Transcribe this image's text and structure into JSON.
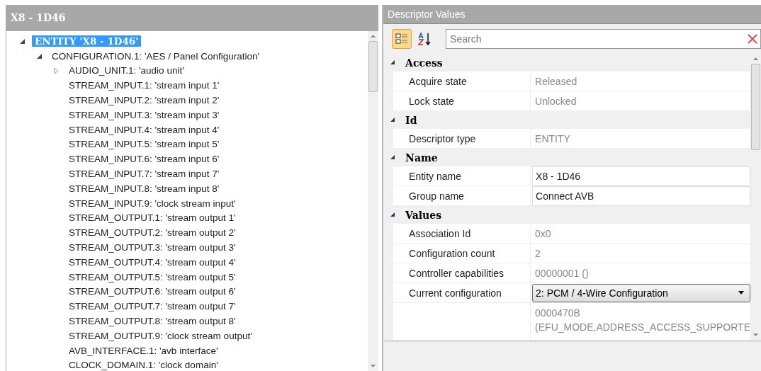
{
  "tree_panel": {
    "title": "X8 - 1D46",
    "tree": [
      {
        "label": "ENTITY 'X8 - 1D46'",
        "selected": true,
        "expanded": true,
        "children": [
          {
            "label": "CONFIGURATION.1: 'AES / Panel Configuration'",
            "selected": false,
            "expanded": true,
            "children": [
              {
                "label": "AUDIO_UNIT.1: 'audio unit'",
                "selected": false,
                "expanded": false
              },
              {
                "label": "STREAM_INPUT.1: 'stream input 1'",
                "selected": false
              },
              {
                "label": "STREAM_INPUT.2: 'stream input 2'",
                "selected": false
              },
              {
                "label": "STREAM_INPUT.3: 'stream input 3'",
                "selected": false
              },
              {
                "label": "STREAM_INPUT.4: 'stream input 4'",
                "selected": false
              },
              {
                "label": "STREAM_INPUT.5: 'stream input 5'",
                "selected": false
              },
              {
                "label": "STREAM_INPUT.6: 'stream input 6'",
                "selected": false
              },
              {
                "label": "STREAM_INPUT.7: 'stream input 7'",
                "selected": false
              },
              {
                "label": "STREAM_INPUT.8: 'stream input 8'",
                "selected": false
              },
              {
                "label": "STREAM_INPUT.9: 'clock stream input'",
                "selected": false
              },
              {
                "label": "STREAM_OUTPUT.1: 'stream output 1'",
                "selected": false
              },
              {
                "label": "STREAM_OUTPUT.2: 'stream output 2'",
                "selected": false
              },
              {
                "label": "STREAM_OUTPUT.3: 'stream output 3'",
                "selected": false
              },
              {
                "label": "STREAM_OUTPUT.4: 'stream output 4'",
                "selected": false
              },
              {
                "label": "STREAM_OUTPUT.5: 'stream output 5'",
                "selected": false
              },
              {
                "label": "STREAM_OUTPUT.6: 'stream output 6'",
                "selected": false
              },
              {
                "label": "STREAM_OUTPUT.7: 'stream output 7'",
                "selected": false
              },
              {
                "label": "STREAM_OUTPUT.8: 'stream output 8'",
                "selected": false
              },
              {
                "label": "STREAM_OUTPUT.9: 'clock stream output'",
                "selected": false
              },
              {
                "label": "AVB_INTERFACE.1: 'avb interface'",
                "selected": false
              },
              {
                "label": "CLOCK_DOMAIN.1: 'clock domain'",
                "selected": false
              }
            ]
          }
        ]
      }
    ]
  },
  "descriptor_panel": {
    "title": "Descriptor Values",
    "toolbar": {
      "categorized": {
        "selected": true
      },
      "alphabetical": {
        "selected": false
      },
      "search": {
        "placeholder": "Search"
      }
    },
    "categories": [
      {
        "name": "Access",
        "expanded": true,
        "properties": [
          {
            "label": "Acquire state",
            "kind": "readonly",
            "value": "Released"
          },
          {
            "label": "Lock state",
            "kind": "readonly",
            "value": "Unlocked"
          }
        ]
      },
      {
        "name": "Id",
        "expanded": true,
        "properties": [
          {
            "label": "Descriptor type",
            "kind": "readonly",
            "value": "ENTITY"
          }
        ]
      },
      {
        "name": "Name",
        "expanded": true,
        "properties": [
          {
            "label": "Entity name",
            "kind": "text",
            "value": "X8 - 1D46"
          },
          {
            "label": "Group name",
            "kind": "text",
            "value": "Connect AVB"
          }
        ]
      },
      {
        "name": "Values",
        "expanded": true,
        "properties": [
          {
            "label": "Association Id",
            "kind": "readonly",
            "value": "0x0"
          },
          {
            "label": "Configuration count",
            "kind": "readonly",
            "value": "2"
          },
          {
            "label": "Controller capabilities",
            "kind": "readonly",
            "value": "00000001 ()"
          },
          {
            "label": "Current configuration",
            "kind": "dropdown",
            "value": "2: PCM / 4-Wire Configuration"
          },
          {
            "kind": "readonly",
            "value": "0000470B (EFU_MODE,ADDRESS_ACCESS_SUPPORTE"
          }
        ]
      }
    ]
  }
}
